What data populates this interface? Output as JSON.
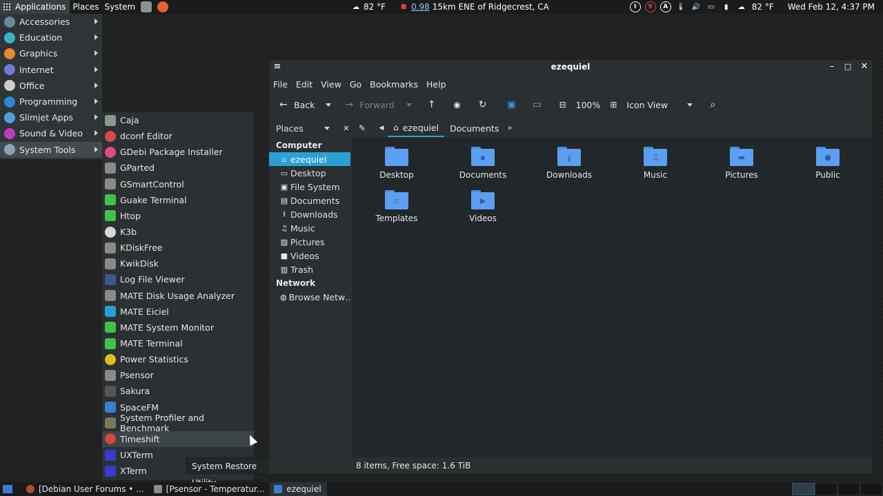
{
  "top_panel": {
    "applications": "Applications",
    "places": "Places",
    "system": "System",
    "weather_left": "82 °F",
    "quake_mag": "0.98",
    "quake_loc": "15km ENE of Ridgecrest, CA",
    "weather_right": "82 °F",
    "clock": "Wed Feb 12,  4:37 PM",
    "tray_i": "I",
    "tray_9": "9",
    "tray_a": "A"
  },
  "app_menu": {
    "categories": [
      {
        "label": "Accessories",
        "color": "#6a8a9a"
      },
      {
        "label": "Education",
        "color": "#3bb3c3"
      },
      {
        "label": "Graphics",
        "color": "#e38b2a"
      },
      {
        "label": "Internet",
        "color": "#6f7bd8"
      },
      {
        "label": "Office",
        "color": "#cfcfcf"
      },
      {
        "label": "Programming",
        "color": "#2f86d6"
      },
      {
        "label": "Slimjet Apps",
        "color": "#4da0e0"
      },
      {
        "label": "Sound & Video",
        "color": "#c13ac4"
      },
      {
        "label": "System Tools",
        "color": "#8aa4b4"
      }
    ]
  },
  "sub_menu": {
    "items": [
      {
        "label": "Caja",
        "color": "#8a9a8a"
      },
      {
        "label": "dconf Editor",
        "color": "#d24a4a"
      },
      {
        "label": "GDebi Package Installer",
        "color": "#e04a8a"
      },
      {
        "label": "GParted",
        "color": "#8a8a8a"
      },
      {
        "label": "GSmartControl",
        "color": "#8a8a8a"
      },
      {
        "label": "Guake Terminal",
        "color": "#3cc44a"
      },
      {
        "label": "Htop",
        "color": "#3cc44a"
      },
      {
        "label": "K3b",
        "color": "#d8d8d8"
      },
      {
        "label": "KDiskFree",
        "color": "#8a8a8a"
      },
      {
        "label": "KwikDisk",
        "color": "#8a8a8a"
      },
      {
        "label": "Log File Viewer",
        "color": "#3a5a8a"
      },
      {
        "label": "MATE Disk Usage Analyzer",
        "color": "#8a8a8a"
      },
      {
        "label": "MATE Eiciel",
        "color": "#2aa0d0"
      },
      {
        "label": "MATE System Monitor",
        "color": "#3cc44a"
      },
      {
        "label": "MATE Terminal",
        "color": "#3cc44a"
      },
      {
        "label": "Power Statistics",
        "color": "#e0c020"
      },
      {
        "label": "Psensor",
        "color": "#8a8a8a"
      },
      {
        "label": "Sakura",
        "color": "#555555"
      },
      {
        "label": "SpaceFM",
        "color": "#3a80d0"
      },
      {
        "label": "System Profiler and Benchmark",
        "color": "#7a7a5a"
      },
      {
        "label": "Timeshift",
        "color": "#d04a3a"
      },
      {
        "label": "UXTerm",
        "color": "#3a3ad0"
      },
      {
        "label": "XTerm",
        "color": "#3a3ad0"
      }
    ],
    "tooltip": "System Restore Utility"
  },
  "window": {
    "title": "ezequiel",
    "menus": [
      "File",
      "Edit",
      "View",
      "Go",
      "Bookmarks",
      "Help"
    ],
    "toolbar": {
      "back": "Back",
      "forward": "Forward",
      "zoom": "100%",
      "view_mode": "Icon View"
    },
    "places_label": "Places",
    "breadcrumbs": [
      "ezequiel",
      "Documents"
    ],
    "sidebar": {
      "computer_heading": "Computer",
      "computer_items": [
        {
          "label": "ezequiel",
          "glyph": "⌂"
        },
        {
          "label": "Desktop",
          "glyph": "▭"
        },
        {
          "label": "File System",
          "glyph": "▣"
        },
        {
          "label": "Documents",
          "glyph": "▤"
        },
        {
          "label": "Downloads",
          "glyph": "⭳"
        },
        {
          "label": "Music",
          "glyph": "♫"
        },
        {
          "label": "Pictures",
          "glyph": "▨"
        },
        {
          "label": "Videos",
          "glyph": "■"
        },
        {
          "label": "Trash",
          "glyph": "▥"
        }
      ],
      "network_heading": "Network",
      "network_items": [
        {
          "label": "Browse Netw…",
          "glyph": "◍"
        }
      ]
    },
    "files": [
      {
        "label": "Desktop",
        "emblem": ""
      },
      {
        "label": "Documents",
        "emblem": "▪"
      },
      {
        "label": "Downloads",
        "emblem": "⭳"
      },
      {
        "label": "Music",
        "emblem": "♫"
      },
      {
        "label": "Pictures",
        "emblem": "▬"
      },
      {
        "label": "Public",
        "emblem": "●"
      },
      {
        "label": "Templates",
        "emblem": "▫"
      },
      {
        "label": "Videos",
        "emblem": "▶"
      }
    ],
    "status": "8 items, Free space: 1.6 TiB"
  },
  "bottom_panel": {
    "tasks": [
      {
        "label": "[Debian User Forums • ...",
        "color": "#b54a2a"
      },
      {
        "label": "[Psensor - Temperatur...",
        "color": "#8a8a8a"
      },
      {
        "label": "ezequiel",
        "color": "#3a80d0"
      }
    ]
  }
}
